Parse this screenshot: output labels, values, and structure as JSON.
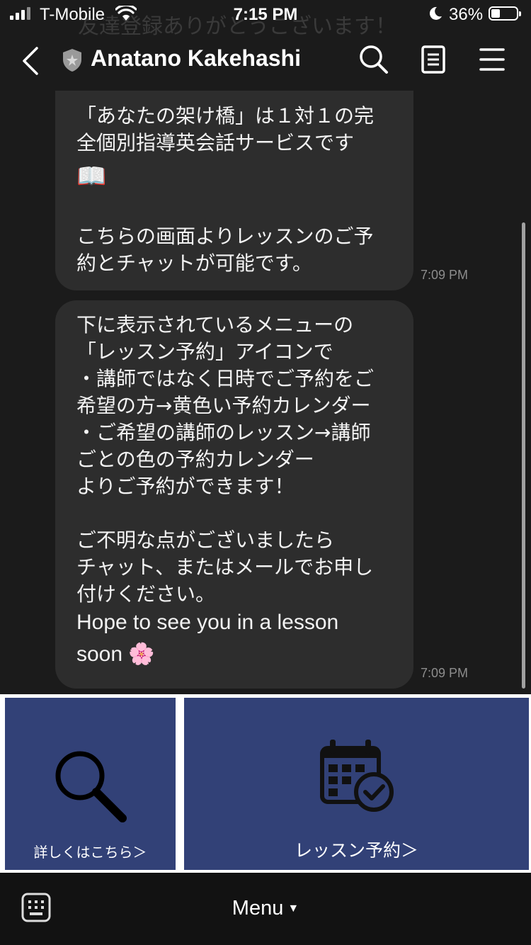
{
  "status_bar": {
    "carrier": "T-Mobile",
    "time": "7:15 PM",
    "battery": "36%",
    "battery_level": 0.36
  },
  "background_text": "友達登録ありがとうございます！",
  "header": {
    "title": "Anatano Kakehashi",
    "icons": [
      "back-chevron-icon",
      "shield-icon",
      "search-icon",
      "note-icon",
      "hamburger-menu-icon"
    ]
  },
  "messages": [
    {
      "lines": [
        "「あなたの架け橋」は１対１の完",
        "全個別指導英会話サービスです",
        "📖",
        "",
        "こちらの画面よりレッスンのご予",
        "約とチャットが可能です。"
      ],
      "time": "7:09 PM"
    },
    {
      "lines": [
        "下に表示されているメニューの",
        "「レッスン予約」アイコンで",
        "・講師ではなく日時でご予約をご",
        "希望の方→黄色い予約カレンダー",
        "・ご希望の講師のレッスン→講師",
        "ごとの色の予約カレンダー",
        "よりご予約ができます！",
        "",
        "ご不明な点がございましたら",
        "チャット、またはメールでお申し",
        "付けください。"
      ],
      "english_lines": [
        "Hope to see you in a lesson",
        "soon 🌸"
      ],
      "time": "7:09 PM"
    }
  ],
  "rich_menu": {
    "items": [
      {
        "label": "詳しくはこちら＞",
        "icon": "magnifier-icon"
      },
      {
        "label": "レッスン予約＞",
        "icon": "calendar-check-icon"
      }
    ]
  },
  "bottom_bar": {
    "menu_label": "Menu",
    "icon": "keyboard-icon"
  }
}
